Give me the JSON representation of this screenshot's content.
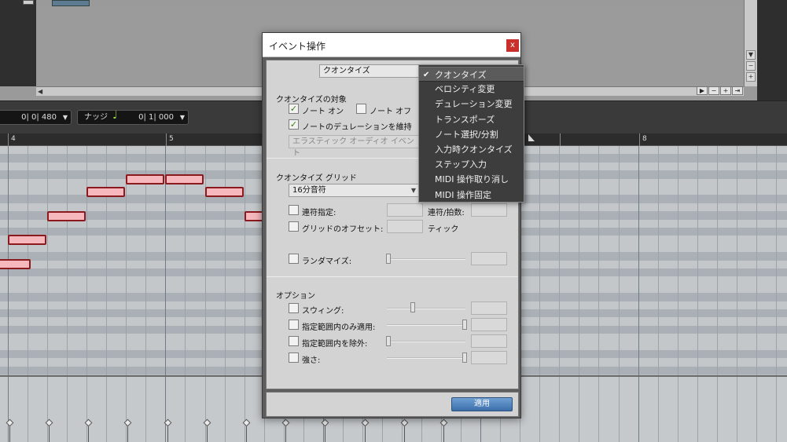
{
  "toolbar": {
    "position_value": "0| 0| 480",
    "nudge_label": "ナッジ",
    "nudge_value": "0| 1| 000"
  },
  "ruler": {
    "bars": [
      "4",
      "5",
      "8"
    ]
  },
  "dialog": {
    "title": "イベント操作",
    "close": "x",
    "operation_select": "クオンタイズ",
    "target_section": "クオンタイズの対象",
    "note_on_label": "ノート オン",
    "note_off_label": "ノート オフ",
    "keep_duration_label": "ノートのデュレーションを維持",
    "elastic_label": "エラスティック オーディオ イベント",
    "grid_section": "クオンタイズ グリッド",
    "grid_select": "16分音符",
    "tuplet_label": "連符指定:",
    "tuplet_count_label": "連符/拍数:",
    "grid_offset_label": "グリッドのオフセット:",
    "tick_label": "ティック",
    "randomize_label": "ランダマイズ:",
    "options_section": "オプション",
    "swing_label": "スウィング:",
    "include_range_label": "指定範囲内のみ適用:",
    "exclude_range_label": "指定範囲内を除外:",
    "strength_label": "強さ:",
    "apply_button": "適用"
  },
  "menu": {
    "items": [
      "クオンタイズ",
      "ベロシティ変更",
      "デュレーション変更",
      "トランスポーズ",
      "ノート選択/分割",
      "入力時クオンタイズ",
      "ステップ入力",
      "MIDI 操作取り消し",
      "MIDI 操作固定"
    ],
    "selected_index": 0,
    "check_glyph": "✔"
  },
  "colors": {
    "note_fill": "#f6b8bd",
    "note_border": "#8b1a1f",
    "apply_button": "#4f80bd",
    "checkbox_check": "#3a7a12"
  }
}
